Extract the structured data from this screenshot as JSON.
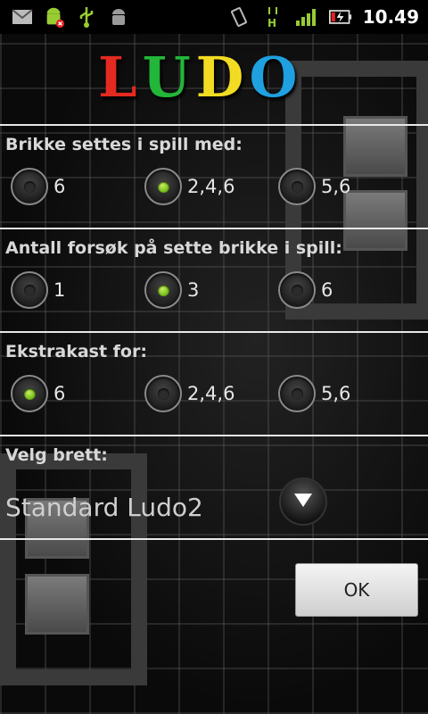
{
  "status_bar": {
    "time": "10.49",
    "icons": [
      "gmail-icon",
      "android-debug-icon",
      "usb-icon",
      "android-icon",
      "vibrate-icon",
      "hspa-data-icon",
      "signal-icon",
      "battery-charging-icon"
    ]
  },
  "logo": {
    "letters": [
      "L",
      "U",
      "D",
      "O"
    ]
  },
  "sections": [
    {
      "title": "Brikke settes i spill med:",
      "options": [
        {
          "label": "6",
          "checked": false
        },
        {
          "label": "2,4,6",
          "checked": true
        },
        {
          "label": "5,6",
          "checked": false
        }
      ]
    },
    {
      "title": "Antall forsøk på sette brikke i spill:",
      "options": [
        {
          "label": "1",
          "checked": false
        },
        {
          "label": "3",
          "checked": true
        },
        {
          "label": "6",
          "checked": false
        }
      ]
    },
    {
      "title": "Ekstrakast for:",
      "options": [
        {
          "label": "6",
          "checked": true
        },
        {
          "label": "2,4,6",
          "checked": false
        },
        {
          "label": "5,6",
          "checked": false
        }
      ]
    }
  ],
  "board_select": {
    "title": "Velg brett:",
    "value": "Standard Ludo2"
  },
  "ok_label": "OK",
  "colors": {
    "accent_green": "#7cc11e",
    "logo_red": "#e42a20",
    "logo_green": "#22b63a",
    "logo_yellow": "#f2dc23",
    "logo_blue": "#1fa0e0"
  }
}
